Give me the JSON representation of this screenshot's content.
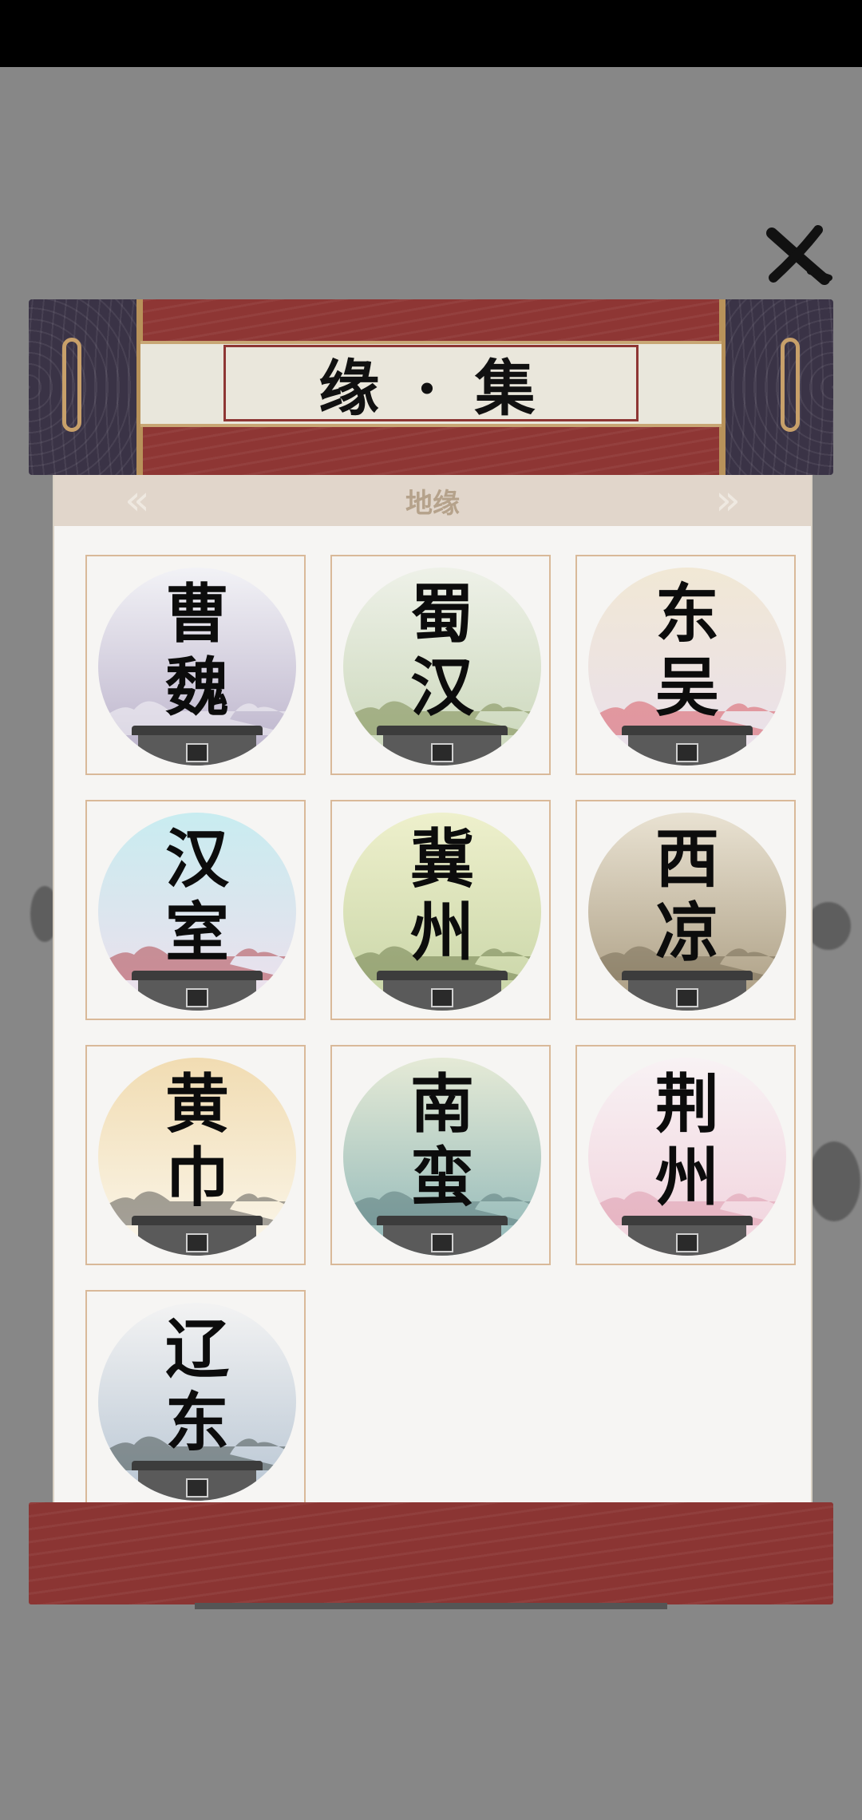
{
  "header": {
    "title": "缘 · 集"
  },
  "tab": {
    "label": "地缘"
  },
  "regions": [
    {
      "name": "曹魏",
      "top": "#f2f2f6",
      "bottom": "#b9b0c9",
      "accent": "#ffffff"
    },
    {
      "name": "蜀汉",
      "top": "#eef1e8",
      "bottom": "#c9d6b8",
      "accent": "#6a7a3a"
    },
    {
      "name": "东吴",
      "top": "#f1e8d5",
      "bottom": "#e9dfec",
      "accent": "#d43d4a"
    },
    {
      "name": "汉室",
      "top": "#c8ecf0",
      "bottom": "#efdfec",
      "accent": "#a3262c"
    },
    {
      "name": "冀州",
      "top": "#eef0cc",
      "bottom": "#c7d4a6",
      "accent": "#5c6b3a"
    },
    {
      "name": "西凉",
      "top": "#e9e2d2",
      "bottom": "#a99b80",
      "accent": "#6b5f4a"
    },
    {
      "name": "黄巾",
      "top": "#f1dcb2",
      "bottom": "#fbf7ec",
      "accent": "#3a3a3a"
    },
    {
      "name": "南蛮",
      "top": "#e5ead6",
      "bottom": "#8fb7b8",
      "accent": "#4e6d6e"
    },
    {
      "name": "荆州",
      "top": "#f8f2f4",
      "bottom": "#f1d2dc",
      "accent": "#d98ea1"
    },
    {
      "name": "辽东",
      "top": "#f3f3f3",
      "bottom": "#b7c5d3",
      "accent": "#2f3a35"
    }
  ]
}
